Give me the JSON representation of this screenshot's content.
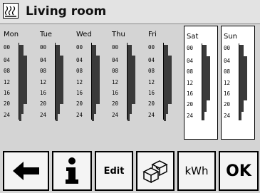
{
  "title": "Living room",
  "title_icon": "heating-icon",
  "days": [
    {
      "name": "Mon",
      "hours": [
        "00",
        "04",
        "08",
        "12",
        "16",
        "20",
        "24"
      ],
      "weekend": false
    },
    {
      "name": "Tue",
      "hours": [
        "00",
        "04",
        "08",
        "12",
        "16",
        "20",
        "24"
      ],
      "weekend": false
    },
    {
      "name": "Wed",
      "hours": [
        "00",
        "04",
        "08",
        "12",
        "16",
        "20",
        "24"
      ],
      "weekend": false
    },
    {
      "name": "Thu",
      "hours": [
        "00",
        "04",
        "08",
        "12",
        "16",
        "20",
        "24"
      ],
      "weekend": false
    },
    {
      "name": "Fri",
      "hours": [
        "00",
        "04",
        "08",
        "12",
        "16",
        "20",
        "24"
      ],
      "weekend": false
    },
    {
      "name": "Sat",
      "hours": [
        "00",
        "04",
        "08",
        "12",
        "16",
        "20",
        "24"
      ],
      "weekend": true
    },
    {
      "name": "Sun",
      "hours": [
        "00",
        "04",
        "08",
        "12",
        "16",
        "20",
        "24"
      ],
      "weekend": true
    }
  ],
  "toolbar": {
    "back_icon": "arrow-left-icon",
    "info_icon": "info-icon",
    "edit_label": "Edit",
    "boxes_icon": "boxes-icon",
    "kwh_label": "kWh",
    "ok_label": "OK"
  }
}
